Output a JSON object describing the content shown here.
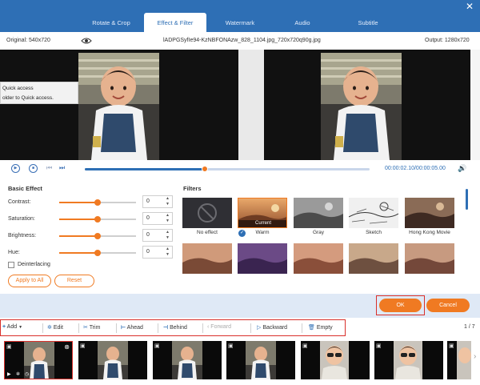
{
  "tabs": [
    {
      "label": "Rotate & Crop",
      "active": false
    },
    {
      "label": "Effect & Filter",
      "active": true
    },
    {
      "label": "Watermark",
      "active": false
    },
    {
      "label": "Audio",
      "active": false
    },
    {
      "label": "Subtitle",
      "active": false
    }
  ],
  "window": {
    "close_glyph": "✕"
  },
  "info": {
    "original": "Original: 540x720",
    "filename": "lADPGSyfIe94-KzNBFONAzw_828_1104.jpg_720x720q90g.jpg",
    "output": "Output: 1280x720"
  },
  "quick_access": {
    "line1": "Quick access",
    "line2": "older to Quick access."
  },
  "playback": {
    "time": "00:00:02.10/00:00:05.00",
    "progress": 0.42
  },
  "basic_effect": {
    "title": "Basic Effect",
    "rows": [
      {
        "label": "Contrast:",
        "value": "0",
        "level": 0.5
      },
      {
        "label": "Saturation:",
        "value": "0",
        "level": 0.5
      },
      {
        "label": "Brightness:",
        "value": "0",
        "level": 0.5
      },
      {
        "label": "Hue:",
        "value": "0",
        "level": 0.5
      }
    ],
    "deinterlacing": "Deinterlacing",
    "apply_all": "Apply to All",
    "reset": "Reset"
  },
  "filters": {
    "title": "Filters",
    "items": [
      {
        "label": "No effect",
        "selected": false
      },
      {
        "label": "Warm",
        "selected": true,
        "badge": "Current"
      },
      {
        "label": "Gray",
        "selected": false
      },
      {
        "label": "Sketch",
        "selected": false
      },
      {
        "label": "Hong Kong Movie",
        "selected": false
      }
    ]
  },
  "actions": {
    "ok": "OK",
    "cancel": "Cancel"
  },
  "toolbar": {
    "add": "Add",
    "edit": "Edit",
    "trim": "Trim",
    "ahead": "Ahead",
    "behind": "Behind",
    "forward": "Forward",
    "backward": "Backward",
    "empty": "Empty",
    "page": "1 / 7"
  },
  "colors": {
    "accent": "#f07a22",
    "primary": "#2e6fb5",
    "highlight": "#d9302b"
  }
}
